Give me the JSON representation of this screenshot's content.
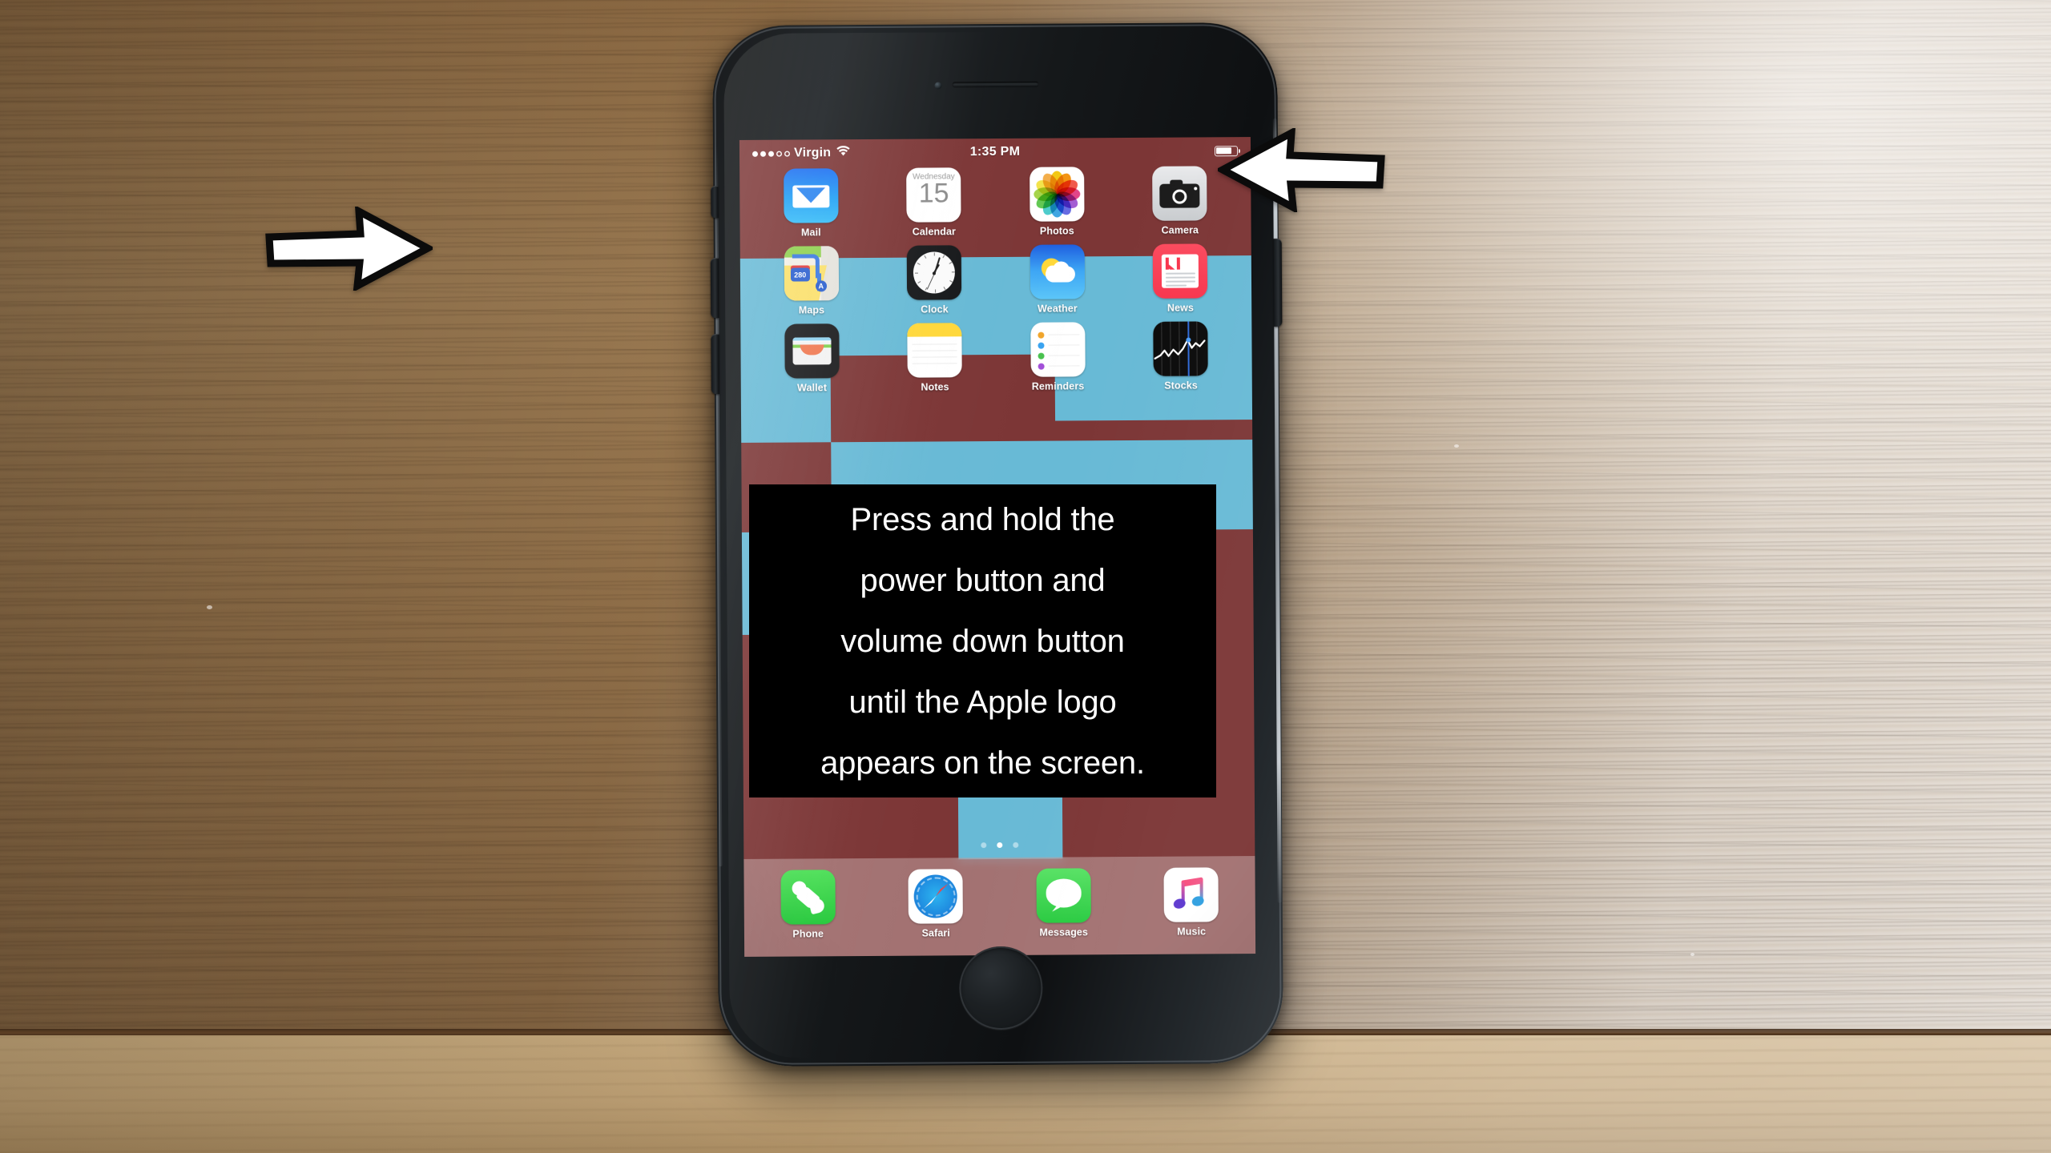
{
  "scene": {
    "surface": "wood-desk",
    "device": "iphone-black"
  },
  "caption": {
    "lines": [
      "Press and hold the",
      "power button and",
      "volume down button",
      "until the Apple logo",
      "appears on the screen."
    ],
    "background_color": "#000000",
    "text_color": "#ffffff"
  },
  "annotations": {
    "left_arrow": {
      "name": "volume-buttons-arrow",
      "direction": "right",
      "points_to": "volume down button"
    },
    "right_arrow": {
      "name": "power-button-arrow",
      "direction": "left",
      "points_to": "power button"
    },
    "fill_color": "#ffffff",
    "stroke_color": "#000000"
  },
  "phone_screen": {
    "status_bar": {
      "signal_dots_filled": 3,
      "signal_dots_total": 5,
      "carrier": "Virgin",
      "wifi": "wifi-icon",
      "time": "1:35 PM",
      "battery_percent": 76,
      "battery_icon": "battery-icon"
    },
    "wallpaper": {
      "colors": [
        "#7c3636",
        "#68bad6"
      ],
      "style": "geometric-blocks"
    },
    "home_grid": [
      {
        "label": "Mail",
        "icon": "mail-icon"
      },
      {
        "label": "Calendar",
        "icon": "calendar-icon",
        "weekday": "Wednesday",
        "day": "15"
      },
      {
        "label": "Photos",
        "icon": "photos-icon"
      },
      {
        "label": "Camera",
        "icon": "camera-icon"
      },
      {
        "label": "Maps",
        "icon": "maps-icon",
        "route_shield": "280",
        "marker": "A"
      },
      {
        "label": "Clock",
        "icon": "clock-icon"
      },
      {
        "label": "Weather",
        "icon": "weather-icon"
      },
      {
        "label": "News",
        "icon": "news-icon"
      },
      {
        "label": "Wallet",
        "icon": "wallet-icon"
      },
      {
        "label": "Notes",
        "icon": "notes-icon"
      },
      {
        "label": "Reminders",
        "icon": "reminders-icon"
      },
      {
        "label": "Stocks",
        "icon": "stocks-icon"
      }
    ],
    "page_dots": {
      "count": 3,
      "active_index": 1
    },
    "dock": [
      {
        "label": "Phone",
        "icon": "phone-icon"
      },
      {
        "label": "Safari",
        "icon": "safari-icon"
      },
      {
        "label": "Messages",
        "icon": "messages-icon"
      },
      {
        "label": "Music",
        "icon": "music-icon"
      }
    ]
  },
  "hardware": {
    "mute_switch": "mute-switch",
    "volume_up": "volume-up-button",
    "volume_down": "volume-down-button",
    "power": "power-button",
    "home": "home-button",
    "earpiece": "earpiece-speaker",
    "front_camera": "front-camera"
  }
}
